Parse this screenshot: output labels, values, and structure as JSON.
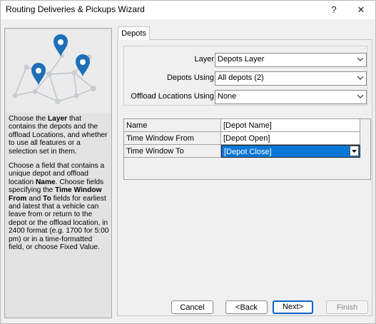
{
  "window": {
    "title": "Routing Deliveries & Pickups Wizard"
  },
  "titlebar": {
    "help_label": "?",
    "close_label": "✕"
  },
  "help": {
    "para1": {
      "pre": "Choose the ",
      "bold1": "Layer",
      "post": " that contains the depots and the offload Locations, and whether to use all features or a selection set in them."
    },
    "para2": {
      "a": "Choose a field that contains a unique depot and offload location ",
      "b1": "Name",
      "c": ". Choose fields specifying the ",
      "b2": "Time Window From",
      "d": " and ",
      "b3": "To",
      "e": " fields for earliest and latest that a vehicle can leave from or return to the depot or the offload location, in 2400 format (e.g. 1700 for 5:00 pm) or in a time-formatted field, or choose Fixed Value."
    }
  },
  "tabs": [
    {
      "label": "Depots"
    }
  ],
  "form": {
    "layer": {
      "label": "Layer",
      "value": "Depots Layer"
    },
    "depots_using": {
      "label": "Depots Using",
      "value": "All depots (2)"
    },
    "offload": {
      "label": "Offload Locations Using",
      "value": "None"
    }
  },
  "grid": {
    "rows": [
      {
        "key": "Name",
        "value": "[Depot Name]"
      },
      {
        "key": "Time Window From",
        "value": "[Depot Open]"
      },
      {
        "key": "Time Window To",
        "value": "[Depot Close]"
      }
    ]
  },
  "buttons": {
    "cancel": "Cancel",
    "back": "<Back",
    "next": "Next>",
    "finish": "Finish"
  },
  "colors": {
    "selection": "#0b78d7",
    "pin": "#1e6fb8"
  }
}
